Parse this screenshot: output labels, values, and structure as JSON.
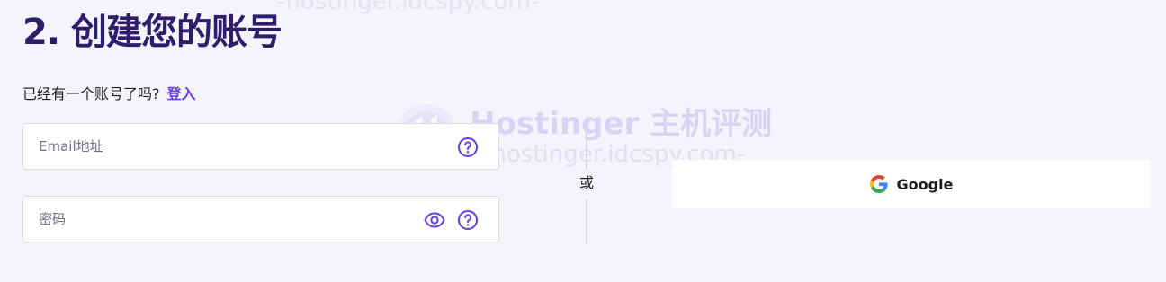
{
  "header": {
    "title": "2. 创建您的账号"
  },
  "login_prompt": {
    "text": "已经有一个账号了吗?",
    "link": "登入"
  },
  "email_field": {
    "value": "",
    "placeholder": "Email地址",
    "help_icon": "question-circle-icon"
  },
  "password_field": {
    "value": "",
    "placeholder": "密码",
    "visibility_icon": "eye-icon",
    "help_icon": "question-circle-icon"
  },
  "divider": {
    "text": "或"
  },
  "google_button": {
    "label": "Google",
    "icon": "google-logo-icon"
  },
  "watermark": {
    "title": "Hostinger 主机评测",
    "url": "-hostinger.idcspy.com-",
    "logo_icon": "hostinger-logo-icon"
  },
  "colors": {
    "background": "#f4f4fd",
    "title": "#2f1c6a",
    "accent": "#673de6",
    "border": "#dadce0",
    "text": "#1d1e20",
    "placeholder": "#6d7081"
  }
}
